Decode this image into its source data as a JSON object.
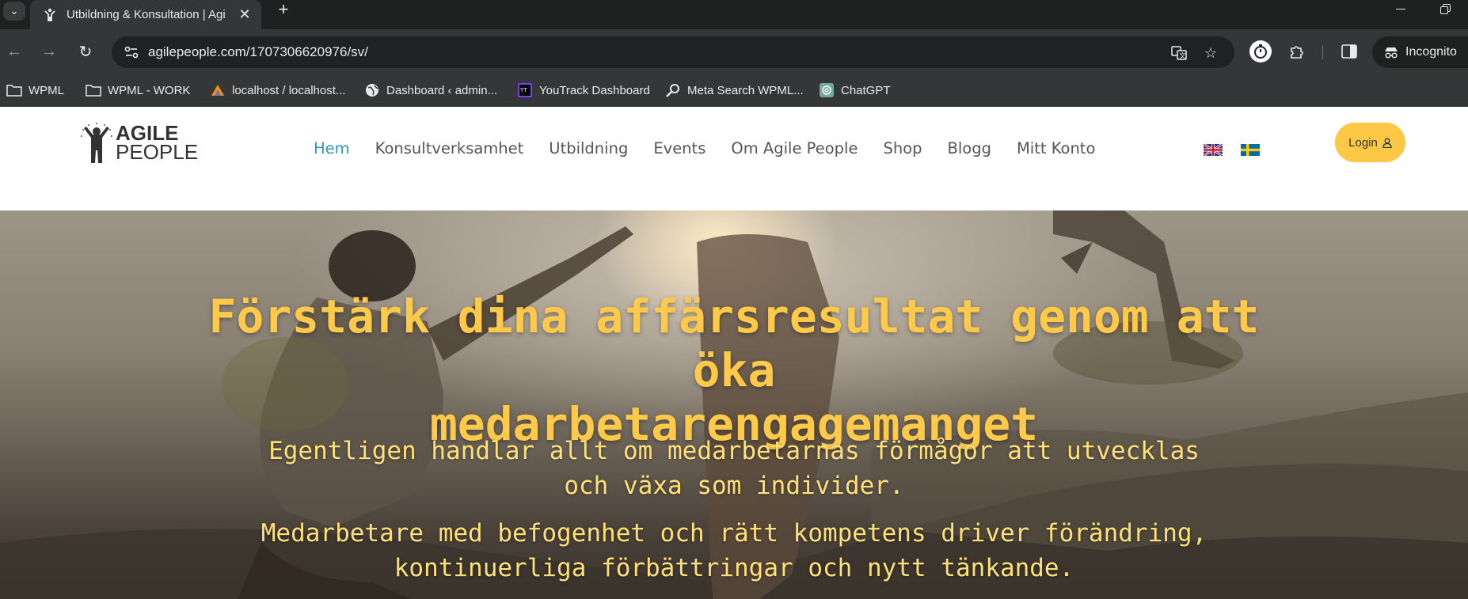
{
  "browser": {
    "tab": {
      "title": "Utbildning & Konsultation | Agi",
      "favicon": "agile-people-figure-icon"
    },
    "new_tab_symbol": "+",
    "url": "agilepeople.com/1707306620976/sv/",
    "incognito_label": "Incognito",
    "bookmarks": [
      {
        "label": "WPML",
        "icon": "folder-icon"
      },
      {
        "label": "WPML - WORK",
        "icon": "folder-icon"
      },
      {
        "label": "localhost / localhost...",
        "icon": "phpmyadmin-icon"
      },
      {
        "label": "Dashboard ‹ admin...",
        "icon": "globe-icon"
      },
      {
        "label": "YouTrack Dashboard",
        "icon": "youtrack-icon"
      },
      {
        "label": "Meta Search WPML...",
        "icon": "magnifier-icon"
      },
      {
        "label": "ChatGPT",
        "icon": "chatgpt-icon"
      }
    ]
  },
  "site": {
    "logo": {
      "line1": "AGILE",
      "line2": "PEOPLE"
    },
    "nav": [
      {
        "label": "Hem",
        "active": true
      },
      {
        "label": "Konsultverksamhet",
        "active": false
      },
      {
        "label": "Utbildning",
        "active": false
      },
      {
        "label": "Events",
        "active": false
      },
      {
        "label": "Om Agile People",
        "active": false
      },
      {
        "label": "Shop",
        "active": false
      },
      {
        "label": "Blogg",
        "active": false
      },
      {
        "label": "Mitt Konto",
        "active": false
      }
    ],
    "languages": [
      "english-flag-icon",
      "swedish-flag-icon"
    ],
    "login_label": "Login",
    "colors": {
      "accent": "#fcc845",
      "active_link": "#2f95b5",
      "hero_title": "#ffc94a"
    }
  },
  "hero": {
    "title_line1": "Förstärk dina affärsresultat genom att öka",
    "title_line2": "medarbetarengagemanget",
    "para1_line1": "Egentligen handlar allt om medarbetarnas förmågor att utvecklas",
    "para1_line2": "och växa som individer.",
    "para2_line1": "Medarbetare med befogenhet och rätt kompetens driver förändring,",
    "para2_line2": "kontinuerliga förbättringar och nytt tänkande."
  }
}
